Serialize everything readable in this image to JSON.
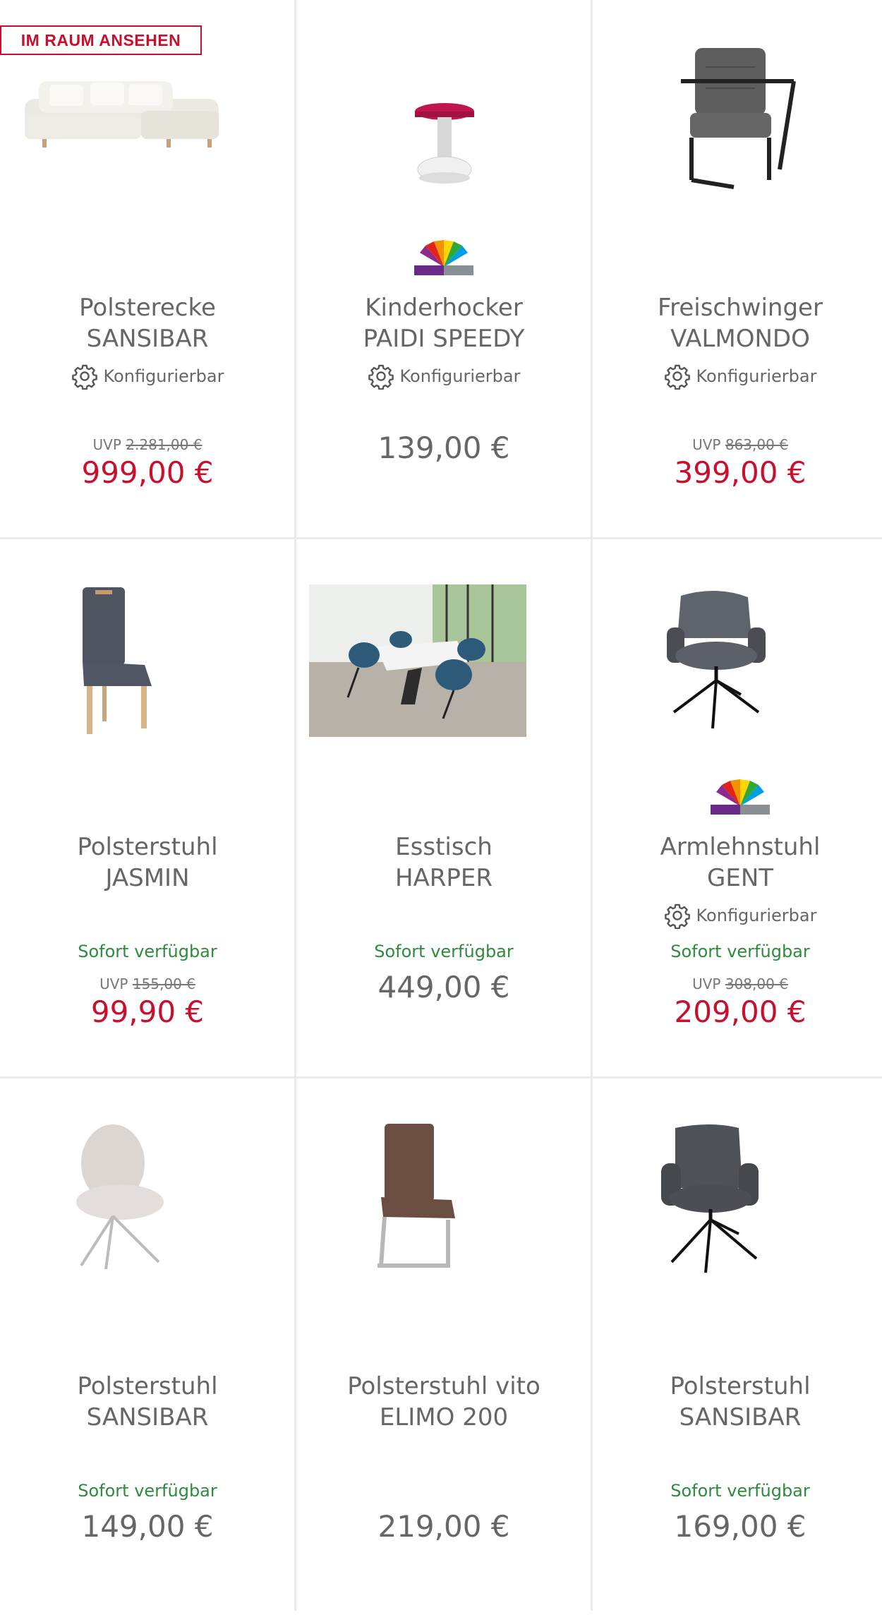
{
  "badge": "IM RAUM ANSEHEN",
  "config_label": "Konfigurierbar",
  "products": [
    {
      "name1": "Polsterecke",
      "name2": "SANSIBAR",
      "uvp_label": "UVP",
      "uvp": "2.281,00 €",
      "price": "999,00 €",
      "availability": ""
    },
    {
      "name1": "Kinderhocker",
      "name2": "PAIDI SPEEDY",
      "uvp_label": "",
      "uvp": "",
      "price": "139,00 €",
      "availability": ""
    },
    {
      "name1": "Freischwinger",
      "name2": "VALMONDO",
      "uvp_label": "UVP",
      "uvp": "863,00 €",
      "price": "399,00 €",
      "availability": ""
    },
    {
      "name1": "Polsterstuhl",
      "name2": "JASMIN",
      "uvp_label": "UVP",
      "uvp": "155,00 €",
      "price": "99,90 €",
      "availability": "Sofort verfügbar"
    },
    {
      "name1": "Esstisch",
      "name2": "HARPER",
      "uvp_label": "",
      "uvp": "",
      "price": "449,00 €",
      "availability": "Sofort verfügbar"
    },
    {
      "name1": "Armlehnstuhl",
      "name2": "GENT",
      "uvp_label": "UVP",
      "uvp": "308,00 €",
      "price": "209,00 €",
      "availability": "Sofort verfügbar"
    },
    {
      "name1": "Polsterstuhl",
      "name2": "SANSIBAR",
      "uvp_label": "",
      "uvp": "",
      "price": "149,00 €",
      "availability": "Sofort verfügbar"
    },
    {
      "name1": "Polsterstuhl vito",
      "name2": "ELIMO 200",
      "uvp_label": "",
      "uvp": "",
      "price": "219,00 €",
      "availability": ""
    },
    {
      "name1": "Polsterstuhl",
      "name2": "SANSIBAR",
      "uvp_label": "",
      "uvp": "",
      "price": "169,00 €",
      "availability": "Sofort verfügbar"
    }
  ],
  "colors": {
    "sale": "#c8102e",
    "available": "#2e8b3d",
    "text": "#666666",
    "divider": "#ebebeb"
  }
}
